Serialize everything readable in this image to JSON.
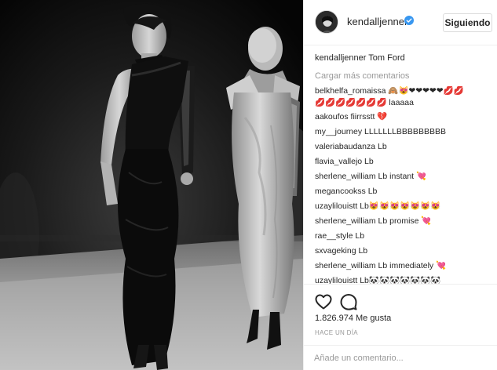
{
  "header": {
    "username": "kendalljenner",
    "follow_label": "Siguiendo"
  },
  "caption": {
    "username": "kendalljenner",
    "text": "Tom Ford"
  },
  "load_more_label": "Cargar más comentarios",
  "comments": [
    {
      "user": "belkhelfa_romaissa",
      "text": "🙈😻❤❤❤❤❤💋💋"
    },
    {
      "user": "",
      "text": "💋💋💋💋💋💋💋 laaaaa"
    },
    {
      "user": "aakoufos",
      "text": "fiirrsstt 💔"
    },
    {
      "user": "my__journey",
      "text": "LLLLLLLBBBBBBBBB"
    },
    {
      "user": "valeriabaudanza",
      "text": "Lb"
    },
    {
      "user": "flavia_vallejo",
      "text": "Lb"
    },
    {
      "user": "sherlene_william",
      "text": "Lb instant 💘"
    },
    {
      "user": "megancookss",
      "text": "Lb"
    },
    {
      "user": "uzaylilouistt",
      "text": "Lb😻😻😻😻😻😻😻"
    },
    {
      "user": "sherlene_william",
      "text": "Lb promise 💘"
    },
    {
      "user": "rae__style",
      "text": "Lb"
    },
    {
      "user": "sxvageking",
      "text": "Lb"
    },
    {
      "user": "sherlene_william",
      "text": "Lb immediately 💘"
    },
    {
      "user": "uzaylilouistt",
      "text": "Lb🐼🐼🐼🐼🐼🐼🐼"
    }
  ],
  "actions": {
    "like_icon": "heart-outline-icon",
    "comment_icon": "speech-bubble-icon",
    "likes": "1.826.974 Me gusta",
    "timestamp": "HACE UN DÍA"
  },
  "add_comment": {
    "placeholder": "Añade un comentario..."
  },
  "colors": {
    "verified_blue": "#3897f0",
    "muted_text": "#999999",
    "primary_text": "#262626",
    "border": "#efefef"
  }
}
